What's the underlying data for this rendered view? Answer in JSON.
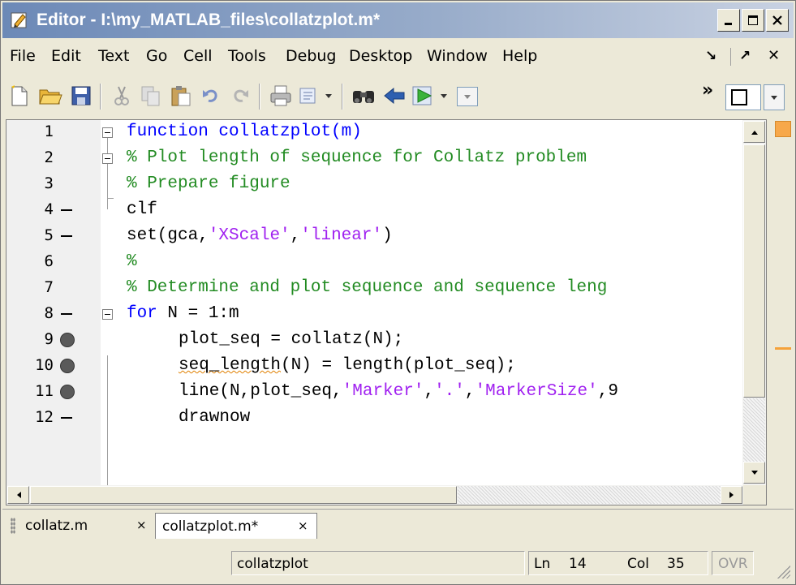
{
  "window": {
    "title": "Editor - I:\\my_MATLAB_files\\collatzplot.m*",
    "minimize": "_",
    "maximize": "□",
    "close": "✕"
  },
  "menu": {
    "items": [
      "File",
      "Edit",
      "Text",
      "Go",
      "Cell",
      "Tools",
      "Debug",
      "Desktop",
      "Window",
      "Help"
    ],
    "dock": "↘",
    "undock": "↗",
    "close": "✕"
  },
  "toolbar": {
    "overflow": "»",
    "icons": [
      "new-file-icon",
      "open-folder-icon",
      "save-icon",
      "cut-icon",
      "copy-icon",
      "paste-icon",
      "undo-icon",
      "redo-icon",
      "print-icon",
      "find-files-icon",
      "find-icon",
      "back-icon",
      "run-icon",
      "dropdown-icon",
      "cell-mode-icon"
    ]
  },
  "editor": {
    "lines": [
      {
        "num": "1",
        "marker": "none",
        "fold": true,
        "code": "function collatzplot(m)"
      },
      {
        "num": "2",
        "marker": "none",
        "fold": true,
        "code": "% Plot length of sequence for Collatz problem"
      },
      {
        "num": "3",
        "marker": "none",
        "fold": false,
        "code": "% Prepare figure"
      },
      {
        "num": "4",
        "marker": "dash",
        "fold": false,
        "code": "clf"
      },
      {
        "num": "5",
        "marker": "dash",
        "fold": false,
        "code": "set(gca,'XScale','linear')"
      },
      {
        "num": "6",
        "marker": "none",
        "fold": false,
        "code": "%"
      },
      {
        "num": "7",
        "marker": "none",
        "fold": false,
        "code": "% Determine and plot sequence and sequence leng"
      },
      {
        "num": "8",
        "marker": "dash",
        "fold": true,
        "code": "for N = 1:m"
      },
      {
        "num": "9",
        "marker": "breakpoint",
        "fold": false,
        "code": "plot_seq = collatz(N);"
      },
      {
        "num": "10",
        "marker": "breakpoint",
        "fold": false,
        "code": "seq_length(N) = length(plot_seq);"
      },
      {
        "num": "11",
        "marker": "breakpoint",
        "fold": false,
        "code": "line(N,plot_seq,'Marker','.','MarkerSize',9"
      },
      {
        "num": "12",
        "marker": "dash",
        "fold": false,
        "code": "drawnow"
      }
    ],
    "colors": {
      "keyword": "#0000ff",
      "comment": "#228b22",
      "string": "#a020f0",
      "warning": "#f5a23a"
    }
  },
  "tabs": [
    {
      "label": "collatz.m",
      "close": "×",
      "active": false
    },
    {
      "label": "collatzplot.m*",
      "close": "×",
      "active": true
    }
  ],
  "status": {
    "function": "collatzplot",
    "ln_label": "Ln",
    "ln_value": "14",
    "col_label": "Col",
    "col_value": "35",
    "mode": "OVR"
  }
}
